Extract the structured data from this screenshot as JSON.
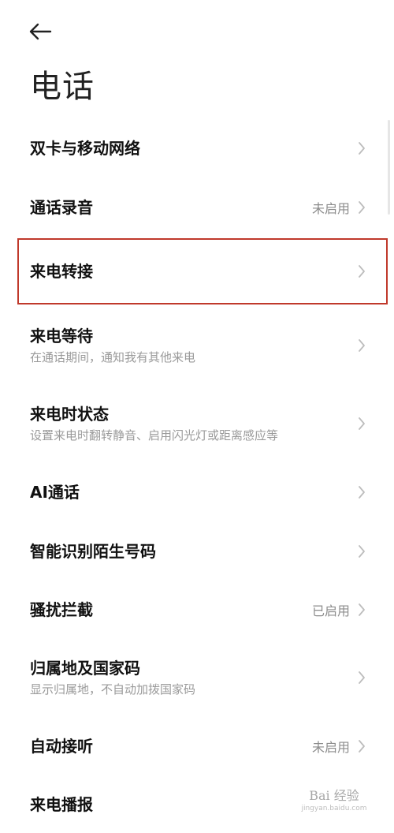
{
  "header": {
    "back_icon": "arrow-left-icon",
    "title": "电话"
  },
  "items": [
    {
      "label": "双卡与移动网络",
      "sub": "",
      "status": ""
    },
    {
      "label": "通话录音",
      "sub": "",
      "status": "未启用"
    },
    {
      "label": "来电转接",
      "sub": "",
      "status": ""
    },
    {
      "label": "来电等待",
      "sub": "在通话期间，通知我有其他来电",
      "status": ""
    },
    {
      "label": "来电时状态",
      "sub": "设置来电时翻转静音、启用闪光灯或距离感应等",
      "status": ""
    },
    {
      "label": "AI通话",
      "sub": "",
      "status": ""
    },
    {
      "label": "智能识别陌生号码",
      "sub": "",
      "status": ""
    },
    {
      "label": "骚扰拦截",
      "sub": "",
      "status": "已启用"
    },
    {
      "label": "归属地及国家码",
      "sub": "显示归属地，不自动加拨国家码",
      "status": ""
    },
    {
      "label": "自动接听",
      "sub": "",
      "status": "未启用"
    },
    {
      "label": "来电播报",
      "sub": "",
      "status": ""
    }
  ],
  "watermark": {
    "text": "Bai 经验",
    "url": "jingyan.baidu.com"
  },
  "colors": {
    "highlight_border": "#c0392b",
    "secondary_text": "#9a9a9a",
    "chevron": "#bdbdbd"
  }
}
